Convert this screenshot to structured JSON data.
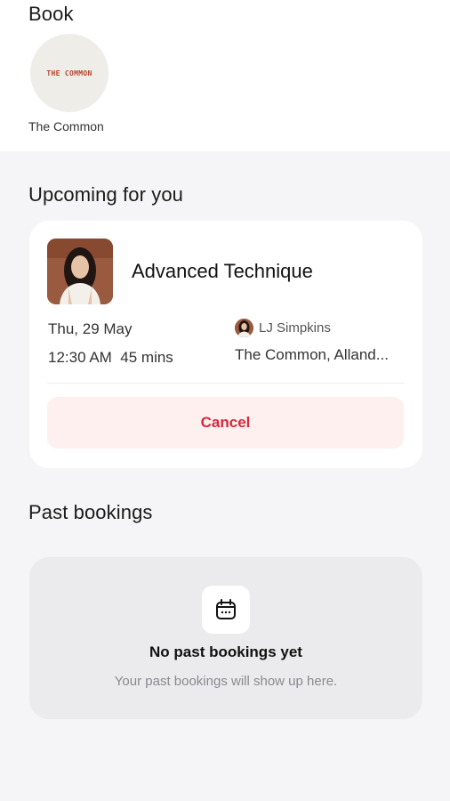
{
  "book": {
    "title": "Book",
    "studio": {
      "logo_text": "THE COMMON",
      "name": "The Common"
    }
  },
  "upcoming": {
    "title": "Upcoming for you",
    "class_name": "Advanced Technique",
    "date": "Thu, 29 May",
    "time": "12:30 AM  45 mins",
    "instructor": "LJ Simpkins",
    "location": "The Common, Alland...",
    "cancel_label": "Cancel"
  },
  "past": {
    "title": "Past bookings",
    "empty_title": "No past bookings yet",
    "empty_subtitle": "Your past bookings will show up here.",
    "icon": "calendar-icon"
  },
  "colors": {
    "accent_red": "#d42a3a",
    "cancel_bg": "#fdf0ef",
    "page_bg": "#f5f5f7"
  }
}
